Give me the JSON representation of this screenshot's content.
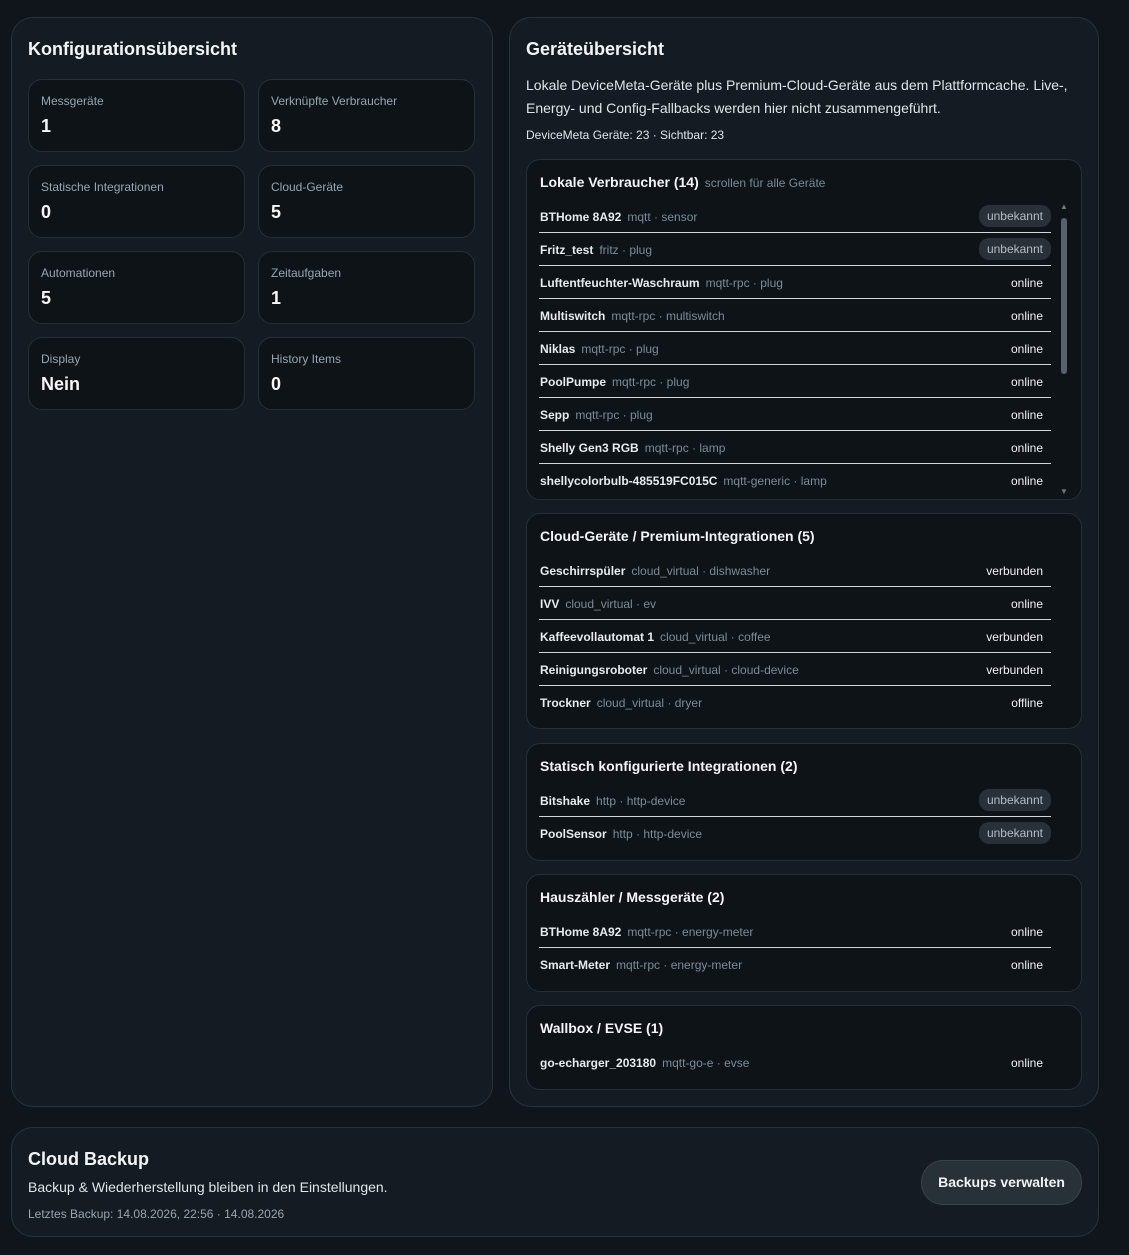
{
  "config": {
    "title": "Konfigurationsübersicht",
    "stats": [
      {
        "label": "Messgeräte",
        "value": "1"
      },
      {
        "label": "Verknüpfte Verbraucher",
        "value": "8"
      },
      {
        "label": "Statische Integrationen",
        "value": "0"
      },
      {
        "label": "Cloud-Geräte",
        "value": "5"
      },
      {
        "label": "Automationen",
        "value": "5"
      },
      {
        "label": "Zeitaufgaben",
        "value": "1"
      },
      {
        "label": "Display",
        "value": "Nein"
      },
      {
        "label": "History Items",
        "value": "0"
      }
    ]
  },
  "devices": {
    "title": "Geräteübersicht",
    "description": "Lokale DeviceMeta-Geräte plus Premium-Cloud-Geräte aus dem Plattformcache. Live-, Energy- und Config-Fallbacks werden hier nicht zusammengeführt.",
    "counts": "DeviceMeta Geräte: 23 · Sichtbar: 23",
    "sections": [
      {
        "title": "Lokale Verbraucher (14)",
        "hint": "scrollen für alle Geräte",
        "rows": [
          {
            "name": "BTHome 8A92",
            "meta": "mqtt · sensor",
            "status": "unbekannt"
          },
          {
            "name": "Fritz_test",
            "meta": "fritz · plug",
            "status": "unbekannt"
          },
          {
            "name": "Luftentfeuchter-Waschraum",
            "meta": "mqtt-rpc · plug",
            "status": "online"
          },
          {
            "name": "Multiswitch",
            "meta": "mqtt-rpc · multiswitch",
            "status": "online"
          },
          {
            "name": "Niklas",
            "meta": "mqtt-rpc · plug",
            "status": "online"
          },
          {
            "name": "PoolPumpe",
            "meta": "mqtt-rpc · plug",
            "status": "online"
          },
          {
            "name": "Sepp",
            "meta": "mqtt-rpc · plug",
            "status": "online"
          },
          {
            "name": "Shelly Gen3 RGB",
            "meta": "mqtt-rpc · lamp",
            "status": "online"
          },
          {
            "name": "shellycolorbulb-485519FC015C",
            "meta": "mqtt-generic · lamp",
            "status": "online"
          }
        ]
      },
      {
        "title": "Cloud-Geräte / Premium-Integrationen (5)",
        "hint": "",
        "rows": [
          {
            "name": "Geschirrspüler",
            "meta": "cloud_virtual · dishwasher",
            "status": "verbunden"
          },
          {
            "name": "IVV",
            "meta": "cloud_virtual · ev",
            "status": "online"
          },
          {
            "name": "Kaffeevollautomat 1",
            "meta": "cloud_virtual · coffee",
            "status": "verbunden"
          },
          {
            "name": "Reinigungsroboter",
            "meta": "cloud_virtual · cloud-device",
            "status": "verbunden"
          },
          {
            "name": "Trockner",
            "meta": "cloud_virtual · dryer",
            "status": "offline"
          }
        ]
      },
      {
        "title": "Statisch konfigurierte Integrationen (2)",
        "hint": "",
        "rows": [
          {
            "name": "Bitshake",
            "meta": "http · http-device",
            "status": "unbekannt"
          },
          {
            "name": "PoolSensor",
            "meta": "http · http-device",
            "status": "unbekannt"
          }
        ]
      },
      {
        "title": "Hauszähler / Messgeräte (2)",
        "hint": "",
        "rows": [
          {
            "name": "BTHome 8A92",
            "meta": "mqtt-rpc · energy-meter",
            "status": "online"
          },
          {
            "name": "Smart-Meter",
            "meta": "mqtt-rpc · energy-meter",
            "status": "online"
          }
        ]
      },
      {
        "title": "Wallbox / EVSE (1)",
        "hint": "",
        "rows": [
          {
            "name": "go-echarger_203180",
            "meta": "mqtt-go-e · evse",
            "status": "online"
          }
        ]
      }
    ]
  },
  "backup": {
    "title": "Cloud Backup",
    "description": "Backup & Wiederherstellung bleiben in den Einstellungen.",
    "last_backup": "Letztes Backup: 14.08.2026, 22:56 · 14.08.2026",
    "button_label": "Backups verwalten"
  }
}
